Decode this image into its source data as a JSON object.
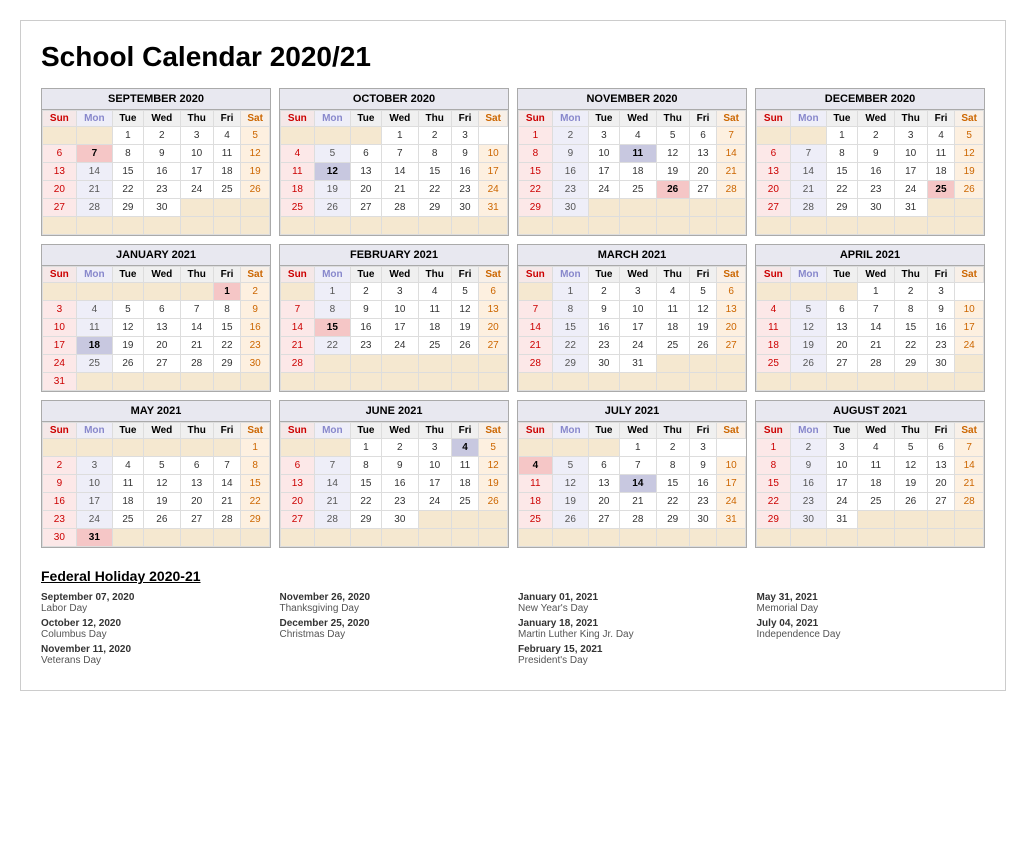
{
  "title": "School Calendar 2020/21",
  "months": [
    {
      "name": "SEPTEMBER 2020",
      "startDay": 2,
      "days": 30,
      "weeks": [
        [
          "",
          "",
          1,
          2,
          3,
          4,
          5
        ],
        [
          6,
          7,
          8,
          9,
          10,
          11,
          12
        ],
        [
          13,
          14,
          15,
          16,
          17,
          18,
          19
        ],
        [
          20,
          21,
          22,
          23,
          24,
          25,
          26
        ],
        [
          27,
          28,
          29,
          30,
          "",
          "",
          ""
        ],
        [
          "",
          "",
          "",
          "",
          "",
          "",
          ""
        ]
      ],
      "holidays": [
        7
      ],
      "schoolStart": [],
      "highlighted": []
    },
    {
      "name": "OCTOBER 2020",
      "startDay": 4,
      "days": 31,
      "weeks": [
        [
          "",
          "",
          "",
          1,
          2,
          3
        ],
        [
          4,
          5,
          6,
          7,
          8,
          9,
          10
        ],
        [
          11,
          12,
          13,
          14,
          15,
          16,
          17
        ],
        [
          18,
          19,
          20,
          21,
          22,
          23,
          24
        ],
        [
          25,
          26,
          27,
          28,
          29,
          30,
          31
        ],
        [
          "",
          "",
          "",
          "",
          "",
          "",
          ""
        ]
      ],
      "holidays": [],
      "schoolStart": [],
      "highlighted": [
        12
      ]
    },
    {
      "name": "NOVEMBER 2020",
      "startDay": 0,
      "days": 30,
      "weeks": [
        [
          1,
          2,
          3,
          4,
          5,
          6,
          7
        ],
        [
          8,
          9,
          10,
          11,
          12,
          13,
          14
        ],
        [
          15,
          16,
          17,
          18,
          19,
          20,
          21
        ],
        [
          22,
          23,
          24,
          25,
          26,
          27,
          28
        ],
        [
          29,
          30,
          "",
          "",
          "",
          "",
          ""
        ],
        [
          "",
          "",
          "",
          "",
          "",
          "",
          ""
        ]
      ],
      "holidays": [
        26
      ],
      "schoolStart": [],
      "highlighted": [
        11
      ]
    },
    {
      "name": "DECEMBER 2020",
      "startDay": 2,
      "days": 31,
      "weeks": [
        [
          "",
          "",
          1,
          2,
          3,
          4,
          5
        ],
        [
          6,
          7,
          8,
          9,
          10,
          11,
          12
        ],
        [
          13,
          14,
          15,
          16,
          17,
          18,
          19
        ],
        [
          20,
          21,
          22,
          23,
          24,
          25,
          26
        ],
        [
          27,
          28,
          29,
          30,
          31,
          "",
          ""
        ],
        [
          "",
          "",
          "",
          "",
          "",
          "",
          ""
        ]
      ],
      "holidays": [
        25
      ],
      "schoolStart": [],
      "highlighted": []
    },
    {
      "name": "JANUARY 2021",
      "startDay": 5,
      "days": 31,
      "weeks": [
        [
          "",
          "",
          "",
          "",
          "",
          1,
          2
        ],
        [
          3,
          4,
          5,
          6,
          7,
          8,
          9
        ],
        [
          10,
          11,
          12,
          13,
          14,
          15,
          16
        ],
        [
          17,
          18,
          19,
          20,
          21,
          22,
          23
        ],
        [
          24,
          25,
          26,
          27,
          28,
          29,
          30
        ],
        [
          31,
          "",
          "",
          "",
          "",
          "",
          ""
        ]
      ],
      "holidays": [
        1
      ],
      "schoolStart": [],
      "highlighted": [
        18
      ]
    },
    {
      "name": "FEBRUARY 2021",
      "startDay": 1,
      "days": 28,
      "weeks": [
        [
          "",
          1,
          2,
          3,
          4,
          5,
          6
        ],
        [
          7,
          8,
          9,
          10,
          11,
          12,
          13
        ],
        [
          14,
          15,
          16,
          17,
          18,
          19,
          20
        ],
        [
          21,
          22,
          23,
          24,
          25,
          26,
          27
        ],
        [
          28,
          "",
          "",
          "",
          "",
          "",
          ""
        ],
        [
          "",
          "",
          "",
          "",
          "",
          "",
          ""
        ]
      ],
      "holidays": [
        15
      ],
      "schoolStart": [],
      "highlighted": [
        15
      ]
    },
    {
      "name": "MARCH 2021",
      "startDay": 1,
      "days": 31,
      "weeks": [
        [
          "",
          1,
          2,
          3,
          4,
          5,
          6
        ],
        [
          7,
          8,
          9,
          10,
          11,
          12,
          13
        ],
        [
          14,
          15,
          16,
          17,
          18,
          19,
          20
        ],
        [
          21,
          22,
          23,
          24,
          25,
          26,
          27
        ],
        [
          28,
          29,
          30,
          31,
          "",
          "",
          ""
        ],
        [
          "",
          "",
          "",
          "",
          "",
          "",
          ""
        ]
      ],
      "holidays": [],
      "schoolStart": [],
      "highlighted": []
    },
    {
      "name": "APRIL 2021",
      "startDay": 4,
      "days": 30,
      "weeks": [
        [
          "",
          "",
          "",
          1,
          2,
          3
        ],
        [
          4,
          5,
          6,
          7,
          8,
          9,
          10
        ],
        [
          11,
          12,
          13,
          14,
          15,
          16,
          17
        ],
        [
          18,
          19,
          20,
          21,
          22,
          23,
          24
        ],
        [
          25,
          26,
          27,
          28,
          29,
          30,
          ""
        ],
        [
          "",
          "",
          "",
          "",
          "",
          "",
          ""
        ]
      ],
      "holidays": [],
      "schoolStart": [],
      "highlighted": []
    },
    {
      "name": "MAY 2021",
      "startDay": 6,
      "days": 31,
      "weeks": [
        [
          "",
          "",
          "",
          "",
          "",
          "",
          1
        ],
        [
          2,
          3,
          4,
          5,
          6,
          7,
          8
        ],
        [
          9,
          10,
          11,
          12,
          13,
          14,
          15
        ],
        [
          16,
          17,
          18,
          19,
          20,
          21,
          22
        ],
        [
          23,
          24,
          25,
          26,
          27,
          28,
          29
        ],
        [
          30,
          31,
          "",
          "",
          "",
          "",
          ""
        ]
      ],
      "holidays": [
        31
      ],
      "schoolStart": [],
      "highlighted": []
    },
    {
      "name": "JUNE 2021",
      "startDay": 2,
      "days": 30,
      "weeks": [
        [
          "",
          "",
          1,
          2,
          3,
          4,
          5
        ],
        [
          6,
          7,
          8,
          9,
          10,
          11,
          12
        ],
        [
          13,
          14,
          15,
          16,
          17,
          18,
          19
        ],
        [
          20,
          21,
          22,
          23,
          24,
          25,
          26
        ],
        [
          27,
          28,
          29,
          30,
          "",
          "",
          ""
        ],
        [
          "",
          "",
          "",
          "",
          "",
          "",
          ""
        ]
      ],
      "holidays": [],
      "schoolStart": [],
      "highlighted": [
        4
      ]
    },
    {
      "name": "JULY 2021",
      "startDay": 4,
      "days": 31,
      "weeks": [
        [
          "",
          "",
          "",
          1,
          2,
          3
        ],
        [
          4,
          5,
          6,
          7,
          8,
          9,
          10
        ],
        [
          11,
          12,
          13,
          14,
          15,
          16,
          17
        ],
        [
          18,
          19,
          20,
          21,
          22,
          23,
          24
        ],
        [
          25,
          26,
          27,
          28,
          29,
          30,
          31
        ],
        [
          "",
          "",
          "",
          "",
          "",
          "",
          ""
        ]
      ],
      "holidays": [
        4
      ],
      "schoolStart": [],
      "highlighted": [
        14
      ]
    },
    {
      "name": "AUGUST 2021",
      "startDay": 0,
      "days": 31,
      "weeks": [
        [
          1,
          2,
          3,
          4,
          5,
          6,
          7
        ],
        [
          8,
          9,
          10,
          11,
          12,
          13,
          14
        ],
        [
          15,
          16,
          17,
          18,
          19,
          20,
          21
        ],
        [
          22,
          23,
          24,
          25,
          26,
          27,
          28
        ],
        [
          29,
          30,
          31,
          "",
          "",
          "",
          ""
        ],
        [
          "",
          "",
          "",
          "",
          "",
          "",
          ""
        ]
      ],
      "holidays": [],
      "schoolStart": [],
      "highlighted": []
    }
  ],
  "holidays_section": {
    "title": "Federal Holiday 2020-21",
    "columns": [
      [
        {
          "date": "September 07, 2020",
          "name": "Labor Day"
        },
        {
          "date": "October 12, 2020",
          "name": "Columbus Day"
        },
        {
          "date": "November 11, 2020",
          "name": "Veterans Day"
        }
      ],
      [
        {
          "date": "November 26, 2020",
          "name": "Thanksgiving Day"
        },
        {
          "date": "December 25, 2020",
          "name": "Christmas Day"
        }
      ],
      [
        {
          "date": "January 01, 2021",
          "name": "New Year's Day"
        },
        {
          "date": "January 18, 2021",
          "name": "Martin Luther King Jr. Day"
        },
        {
          "date": "February 15, 2021",
          "name": "President's Day"
        }
      ],
      [
        {
          "date": "May 31, 2021",
          "name": "Memorial Day"
        },
        {
          "date": "July 04, 2021",
          "name": "Independence Day"
        }
      ]
    ]
  },
  "days_header": [
    "Sun",
    "Mon",
    "Tue",
    "Wed",
    "Thu",
    "Fri",
    "Sat"
  ]
}
